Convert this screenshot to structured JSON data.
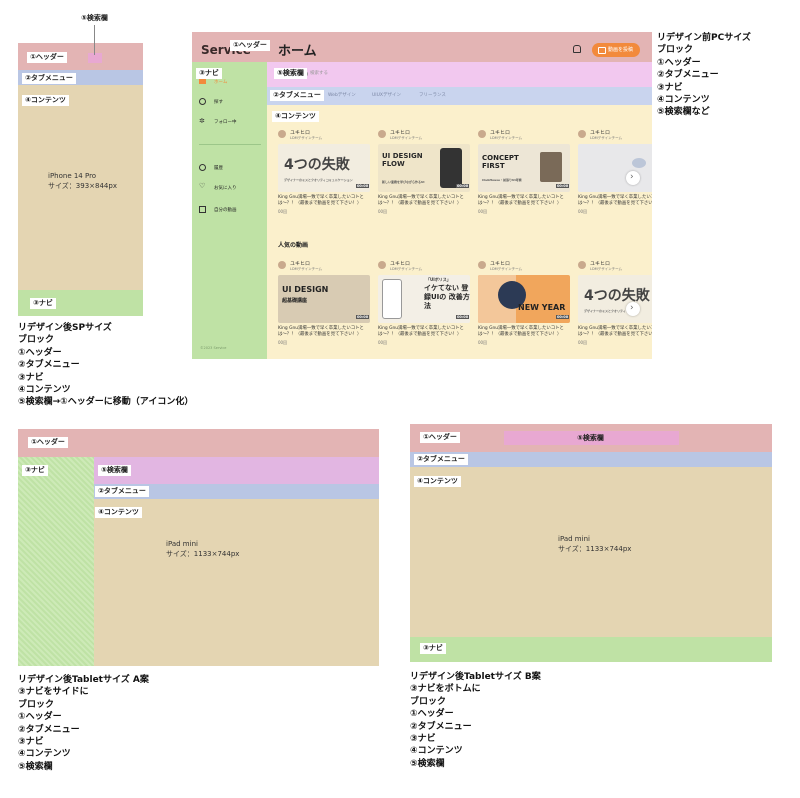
{
  "labels": {
    "header": "①ヘッダー",
    "tab_menu": "②タブメニュー",
    "nav": "③ナビ",
    "contents": "④コンテンツ",
    "search": "⑤検索欄"
  },
  "sp": {
    "device": "iPhone 14 Pro",
    "size": "サイズ：393×844px",
    "note": [
      "リデザイン後SPサイズ",
      "ブロック",
      "①ヘッダー",
      "②タブメニュー",
      "③ナビ",
      "④コンテンツ",
      "⑤検索欄→①ヘッダーに移動（アイコン化）"
    ]
  },
  "pc": {
    "logo": "Service",
    "title": "ホーム",
    "post_button": "動画を投稿",
    "search_placeholder": "検索する",
    "tabs": [
      "Webデザイン",
      "UIUXデザイン",
      "フリーランス"
    ],
    "nav_items": [
      {
        "icon": "home-icon",
        "label": "ホーム"
      },
      {
        "icon": "compass-icon",
        "label": "探す"
      },
      {
        "icon": "follow-icon",
        "label": "フォロー中"
      },
      {
        "icon": "clock-icon",
        "label": "履歴"
      },
      {
        "icon": "heart-icon",
        "label": "お気に入り"
      },
      {
        "icon": "video-icon",
        "label": "自分の動画"
      }
    ],
    "footer": "©2023 Service",
    "popular_heading": "人気の動画",
    "channel_name": "ユキヒロ",
    "channel_sub": "LDMデザインチーム",
    "video_caption": "King Gnu満場一致で早く卒業したいコトとは〜？！（最後まで動画を見て下さい！）",
    "views": "00回",
    "duration": "00:00",
    "row1_thumbs": [
      {
        "main": "4つの失敗",
        "sub": "デザイナーのミスとクオリティコミュニケーション",
        "bg": "#f2ede0",
        "color": "#444"
      },
      {
        "main": "UI DESIGN FLOW",
        "sub": "新しい業務を学びながら作るUI",
        "bg": "#efe5c9",
        "color": "#2a2a2a"
      },
      {
        "main": "CONCEPT FIRST",
        "sub": "ClubHouse・前張りUI考察",
        "bg": "#ede6d6",
        "color": "#222"
      },
      {
        "main": "",
        "sub": "",
        "bg": "#e8e8ea",
        "color": "#222"
      }
    ],
    "row2_thumbs": [
      {
        "main": "UI DESIGN",
        "sub": "超基礎講座",
        "bg": "#d8cbb3",
        "color": "#222"
      },
      {
        "main": "",
        "sub": "",
        "bg": "#f1ebe2",
        "color": "#222"
      },
      {
        "main": "イケてない 登録UIの 改善方法",
        "sub": "「UIボリス」",
        "bg": "#f3efe6",
        "color": "#222"
      },
      {
        "main": "NEW YEAR",
        "sub": "",
        "bg": "#f1a65c",
        "color": "#222"
      },
      {
        "main": "4つの失敗",
        "sub": "デザイナーのミスとクオリティ",
        "bg": "#f2ede0",
        "color": "#444"
      }
    ],
    "note": [
      "リデザイン前PCサイズ",
      "ブロック",
      "①ヘッダー",
      "②タブメニュー",
      "③ナビ",
      "④コンテンツ",
      "⑤検索欄など"
    ]
  },
  "tablet_a": {
    "device": "iPad mini",
    "size": "サイズ：1133×744px",
    "note": [
      "リデザイン後Tabletサイズ A案",
      "③ナビをサイドに",
      "ブロック",
      "①ヘッダー",
      "②タブメニュー",
      "③ナビ",
      "④コンテンツ",
      "⑤検索欄"
    ]
  },
  "tablet_b": {
    "device": "iPad mini",
    "size": "サイズ：1133×744px",
    "note": [
      "リデザイン後Tabletサイズ B案",
      "③ナビをボトムに",
      "ブロック",
      "①ヘッダー",
      "②タブメニュー",
      "③ナビ",
      "④コンテンツ",
      "⑤検索欄"
    ]
  },
  "colors": {
    "header": "#e3b4b4",
    "tab_menu": "#b9c6e4",
    "contents": "#e4d5b2",
    "nav": "#bfe2a5",
    "search": "#e2b6e2",
    "pc_bg": "#fbf0cc",
    "accent_orange": "#f28a3c"
  }
}
